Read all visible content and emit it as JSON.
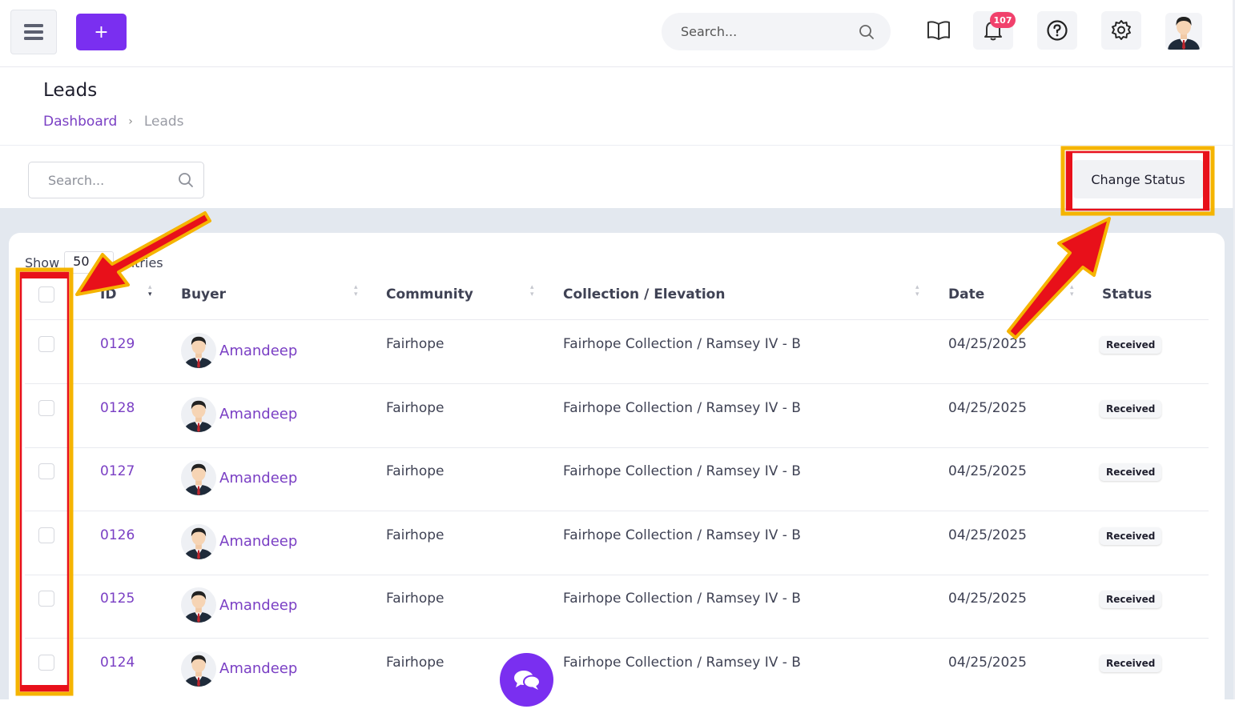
{
  "topbar": {
    "menu_icon": "hamburger-icon",
    "add_label": "+",
    "search_placeholder": "Search...",
    "notification_count": "107"
  },
  "page": {
    "title": "Leads",
    "breadcrumb": [
      "Dashboard",
      "Leads"
    ],
    "breadcrumb_sep": "›"
  },
  "filter": {
    "search_placeholder": "Search...",
    "change_status_label": "Change Status"
  },
  "table": {
    "show_label": "Show",
    "show_value": "50",
    "entries_label": "entries",
    "columns": [
      "ID",
      "Buyer",
      "Community",
      "Collection / Elevation",
      "Date",
      "Status"
    ],
    "rows": [
      {
        "id": "0129",
        "buyer": "Amandeep",
        "community": "Fairhope",
        "collection": "Fairhope Collection / Ramsey IV - B",
        "date": "04/25/2025",
        "status": "Received"
      },
      {
        "id": "0128",
        "buyer": "Amandeep",
        "community": "Fairhope",
        "collection": "Fairhope Collection / Ramsey IV - B",
        "date": "04/25/2025",
        "status": "Received"
      },
      {
        "id": "0127",
        "buyer": "Amandeep",
        "community": "Fairhope",
        "collection": "Fairhope Collection / Ramsey IV - B",
        "date": "04/25/2025",
        "status": "Received"
      },
      {
        "id": "0126",
        "buyer": "Amandeep",
        "community": "Fairhope",
        "collection": "Fairhope Collection / Ramsey IV - B",
        "date": "04/25/2025",
        "status": "Received"
      },
      {
        "id": "0125",
        "buyer": "Amandeep",
        "community": "Fairhope",
        "collection": "Fairhope Collection / Ramsey IV - B",
        "date": "04/25/2025",
        "status": "Received"
      },
      {
        "id": "0124",
        "buyer": "Amandeep",
        "community": "Fairhope",
        "collection": "Fairhope Collection / Ramsey IV - B",
        "date": "04/25/2025",
        "status": "Received"
      }
    ]
  },
  "colors": {
    "accent": "#7a2ff0",
    "link": "#7a3fc4",
    "badge": "#f1416c",
    "annotation_arrow": "#e8101a",
    "annotation_outline": "#f5b400"
  }
}
